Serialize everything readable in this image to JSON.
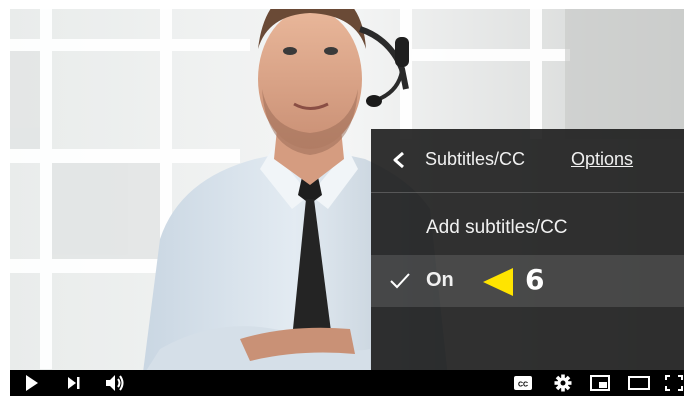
{
  "menu": {
    "title": "Subtitles/CC",
    "options_label": "Options",
    "items": [
      {
        "label": "Add subtitles/CC",
        "selected": false
      },
      {
        "label": "On",
        "selected": true
      }
    ]
  },
  "annotation": {
    "step_number": "6",
    "arrow_color": "#ffe400"
  },
  "controls": {
    "icons": [
      "play-icon",
      "next-icon",
      "volume-icon",
      "cc-icon",
      "settings-icon",
      "miniplayer-icon",
      "theater-icon",
      "fullscreen-icon"
    ],
    "cc_badge": "CC"
  },
  "colors": {
    "panel_bg": "#1c1c1c",
    "text": "#f1f1f1",
    "controls_bg": "#000000"
  }
}
